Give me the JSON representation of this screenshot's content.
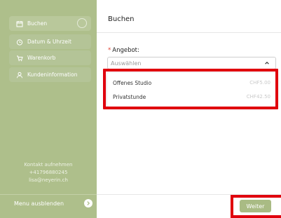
{
  "sidebar": {
    "items": [
      {
        "label": "Buchen",
        "icon": "calendar-icon"
      },
      {
        "label": "Datum & Uhrzeit",
        "icon": "clock-icon"
      },
      {
        "label": "Warenkorb",
        "icon": "cart-icon"
      },
      {
        "label": "Kundeninformation",
        "icon": "user-icon"
      }
    ],
    "contact": {
      "title": "Kontakt aufnehmen",
      "phone": "+41796880245",
      "email": "lisa@neyerin.ch"
    },
    "menu_hide_label": "Menu ausblenden"
  },
  "header": {
    "title": "Buchen"
  },
  "form": {
    "required_mark": "*",
    "angebot_label": "Angebot:",
    "select_placeholder": "Auswählen",
    "options": [
      {
        "name": "Offenes Studio",
        "price": "CHF5.00"
      },
      {
        "name": "Privatstunde",
        "price": "CHF42.50"
      }
    ]
  },
  "footer": {
    "next_label": "Weiter"
  },
  "colors": {
    "accent": "#a9bb84",
    "sidebar": "#aebf8b",
    "highlight": "#e0000d"
  }
}
